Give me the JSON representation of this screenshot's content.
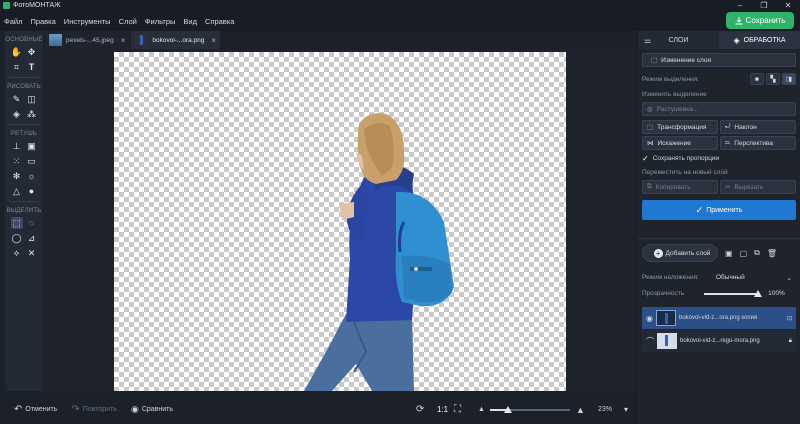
{
  "app": {
    "title": "ФотоМОНТАЖ",
    "accent": "#2fb36a",
    "blue": "#1f78d1"
  },
  "menu": [
    "Файл",
    "Правка",
    "Инструменты",
    "Слой",
    "Фильтры",
    "Вид",
    "Справка"
  ],
  "save_label": "Сохранить",
  "tools": {
    "sections": [
      "ОСНОВНЫЕ",
      "РИСОВАТЬ",
      "РЕТУШЬ",
      "ВЫДЕЛИТЬ"
    ]
  },
  "tabs": [
    {
      "label": "pexels-...45.jpeg"
    },
    {
      "label": "bokovoi-...ora.png"
    }
  ],
  "bottom": {
    "undo": "Отменить",
    "redo": "Повторить",
    "compare": "Сравнить",
    "ratio": "1:1",
    "zoom": "23%",
    "zoom_fraction": 0.23
  },
  "panel": {
    "tab_layers": "СЛОИ",
    "tab_processing": "ОБРАБОТКА",
    "change_layer": "Изменение слоя",
    "selection_mode_label": "Режим выделения:",
    "change_selection_label": "Изменить выделение",
    "feather": "Растушевка...",
    "transform": "Трансформация",
    "tilt": "Наклон",
    "distortion": "Искажение",
    "perspective": "Перспектива",
    "keep_proportions": "Сохранять пропорции",
    "move_to_new_layer": "Переместить на новый слой",
    "copy": "Копировать",
    "cut": "Вырезать",
    "apply": "Применить",
    "add_layer": "Добавить слой",
    "blend_mode_label": "Режим наложения:",
    "blend_mode_value": "Обычный",
    "opacity_label": "Прозрачность",
    "opacity_value": "100%",
    "opacity_fraction": 1.0,
    "layers": [
      {
        "name": "bokovoi-vid-z...ora.png копия"
      },
      {
        "name": "bokovoi-vid-z...regu-mora.png"
      }
    ]
  }
}
